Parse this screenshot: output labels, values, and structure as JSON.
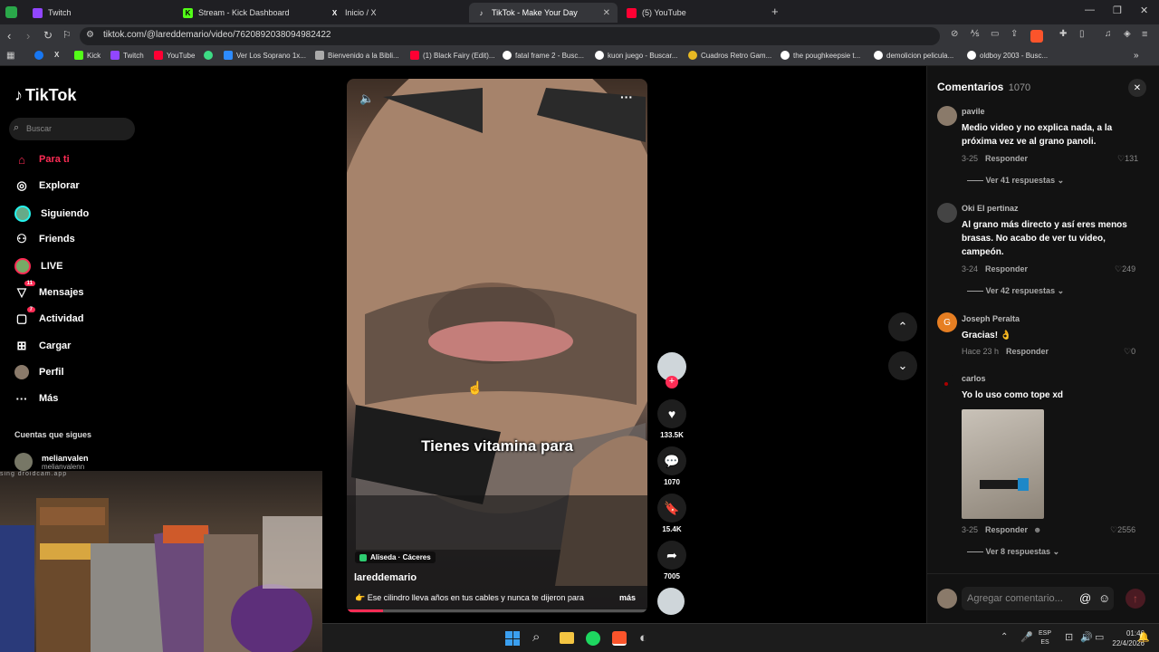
{
  "browser": {
    "tabs": [
      {
        "label": "Twitch",
        "icon": "twitch-icon",
        "color": "#9146ff"
      },
      {
        "label": "Stream - Kick Dashboard",
        "icon": "kick-icon",
        "color": "#53fc18"
      },
      {
        "label": "Inicio / X",
        "icon": "x-icon",
        "color": "#ffffff"
      },
      {
        "label": "TikTok - Make Your Day",
        "icon": "tiktok-icon",
        "color": "#ffffff"
      },
      {
        "label": "(5) YouTube",
        "icon": "youtube-icon",
        "color": "#ff0033"
      }
    ],
    "url": "tiktok.com/@lareddemario/video/7620892038094982422",
    "bookmarks": [
      {
        "label": "",
        "color": "#1877f2"
      },
      {
        "label": "",
        "color": "#ffffff"
      },
      {
        "label": "Kick",
        "color": "#53fc18"
      },
      {
        "label": "Twitch",
        "color": "#9146ff"
      },
      {
        "label": "YouTube",
        "color": "#ff0033"
      },
      {
        "label": "",
        "color": "#3ddc84"
      },
      {
        "label": "Ver Los Soprano 1x...",
        "color": "#2d8cff"
      },
      {
        "label": "Bienvenido a la Bibli...",
        "color": "#aaaaaa"
      },
      {
        "label": "(1) Black Fairy (Edit)...",
        "color": "#ff0033"
      },
      {
        "label": "fatal frame 2 - Busc...",
        "color": "#ffffff"
      },
      {
        "label": "kuon juego - Buscar...",
        "color": "#ffffff"
      },
      {
        "label": "Cuadros Retro Gam...",
        "color": "#e8b923"
      },
      {
        "label": "the poughkeepsie t...",
        "color": "#ffffff"
      },
      {
        "label": "demolicion pelicula...",
        "color": "#ffffff"
      },
      {
        "label": "oldboy 2003 - Busc...",
        "color": "#ffffff"
      }
    ]
  },
  "sidebar": {
    "logo": "TikTok",
    "search_placeholder": "Buscar",
    "items": [
      {
        "label": "Para ti",
        "icon": "home-icon",
        "active": true
      },
      {
        "label": "Explorar",
        "icon": "compass-icon"
      },
      {
        "label": "Siguiendo",
        "icon": "following-avatar-icon"
      },
      {
        "label": "Friends",
        "icon": "friends-icon"
      },
      {
        "label": "LIVE",
        "icon": "live-avatar-icon"
      },
      {
        "label": "Mensajes",
        "icon": "messages-icon",
        "badge": "11"
      },
      {
        "label": "Actividad",
        "icon": "activity-icon",
        "badge": "7"
      },
      {
        "label": "Cargar",
        "icon": "upload-icon"
      },
      {
        "label": "Perfil",
        "icon": "profile-avatar-icon"
      },
      {
        "label": "Más",
        "icon": "more-dots-icon"
      }
    ],
    "following_title": "Cuentas que sigues",
    "following": [
      {
        "name": "melianvalen",
        "handle": "melianvalenn"
      }
    ]
  },
  "video": {
    "caption_overlay": "Tienes vitamina para",
    "location": "Aliseda · Cáceres",
    "author": "lareddemario",
    "description": "👉 Ese cilindro lleva años en tus cables y nunca te dijeron para",
    "more_label": "más",
    "progress": 0.12
  },
  "actions": {
    "likes": "133.5K",
    "comments": "1070",
    "saves": "15.4K",
    "shares": "7005"
  },
  "comments_panel": {
    "title": "Comentarios",
    "count": "1070",
    "input_placeholder": "Agregar comentario...",
    "reply_label": "Responder",
    "items": [
      {
        "user": "pavile",
        "text": "Medio video y no explica nada, a la próxima vez ve al grano panoli.",
        "date": "3-25",
        "likes": "131",
        "replies": "Ver 41 respuestas"
      },
      {
        "user": "Oki El pertinaz",
        "text": "Al grano más directo y así eres menos brasas. No acabo de ver tu video, campeón.",
        "date": "3-24",
        "likes": "249",
        "replies": "Ver 42 respuestas"
      },
      {
        "user": "Joseph Peralta",
        "text": "Gracias! 👌",
        "date": "Hace 23 h",
        "likes": "0",
        "replies": ""
      },
      {
        "user": "carlos",
        "text": "Yo lo uso como tope xd",
        "date": "3-25",
        "likes": "2556",
        "replies": "Ver 8 respuestas"
      }
    ]
  },
  "webcam": {
    "watermark": "sing droidcam.app"
  },
  "taskbar": {
    "lang_top": "ESP",
    "lang_bottom": "ES",
    "time": "01:46",
    "date": "22/4/2026"
  }
}
